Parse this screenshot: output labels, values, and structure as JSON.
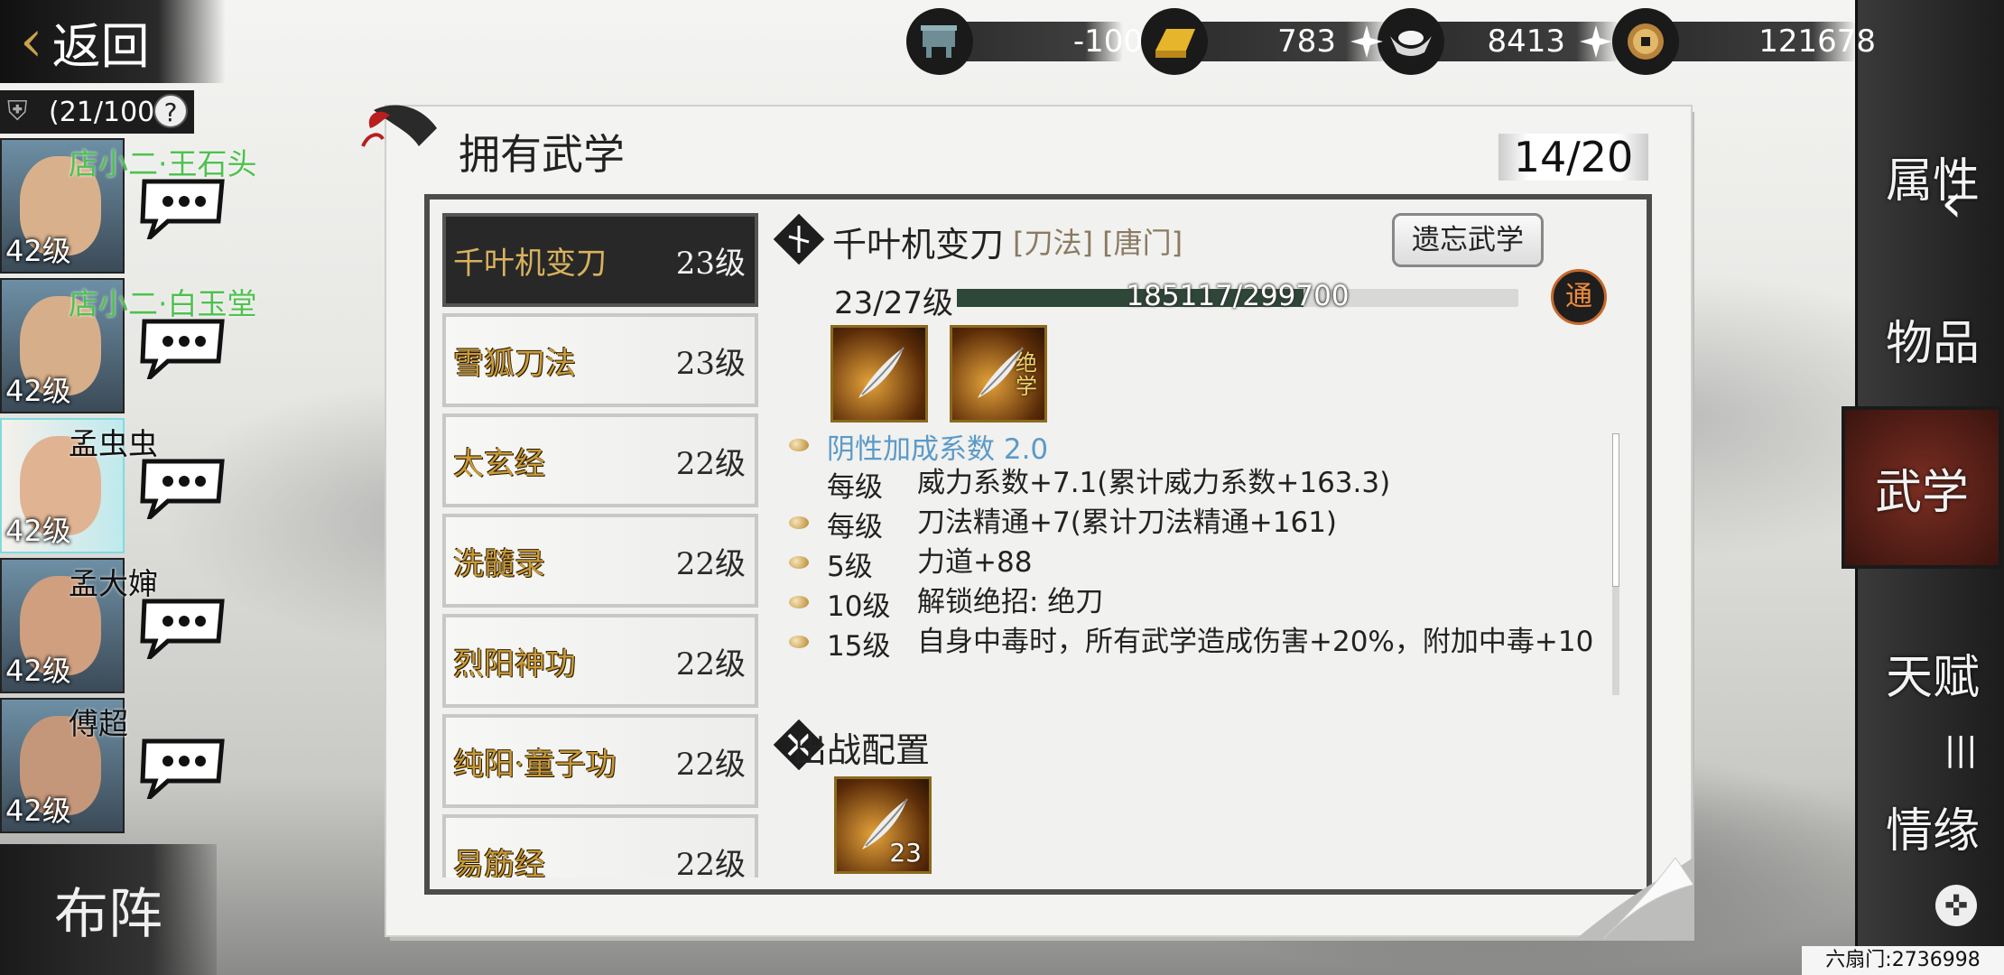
{
  "back": {
    "label": "返回"
  },
  "party": {
    "count": "(21/100",
    "help": "?"
  },
  "members": [
    {
      "name": "店小二·王石头",
      "level": "42级",
      "name_color": "#4ec24e",
      "skin": "#d8b08c"
    },
    {
      "name": "店小二·白玉堂",
      "level": "42级",
      "name_color": "#4ec24e",
      "skin": "#d6ae8a"
    },
    {
      "name": "孟虫虫",
      "level": "42级",
      "name_color": "#111111",
      "skin": "#e0b492"
    },
    {
      "name": "孟大婶",
      "level": "42级",
      "name_color": "#111111",
      "skin": "#cf9f80"
    },
    {
      "name": "傅超",
      "level": "42级",
      "name_color": "#111111",
      "skin": "#c4977a"
    }
  ],
  "formation": {
    "label": "布阵"
  },
  "currencies": [
    {
      "icon": "cart-icon",
      "value": "-100",
      "has_plus": false
    },
    {
      "icon": "gold-bar-icon",
      "value": "783",
      "has_plus": true
    },
    {
      "icon": "silver-ingot-icon",
      "value": "8413",
      "has_plus": true
    },
    {
      "icon": "coin-icon",
      "value": "121678",
      "has_plus": false
    }
  ],
  "nav": [
    {
      "label": "属性",
      "icon": "attribute-icon"
    },
    {
      "label": "物品",
      "icon": "items-icon"
    },
    {
      "label": "武学",
      "icon": "martial-arts-icon",
      "active": true
    },
    {
      "label": "天赋",
      "icon": "talent-icon"
    },
    {
      "label": "情缘",
      "icon": "relationship-icon"
    }
  ],
  "panel": {
    "title": "拥有武学",
    "count": "14/20"
  },
  "skills": [
    {
      "name": "千叶机变刀",
      "level": "23级",
      "active": true
    },
    {
      "name": "雪狐刀法",
      "level": "23级"
    },
    {
      "name": "太玄经",
      "level": "22级"
    },
    {
      "name": "洗髓录",
      "level": "22级"
    },
    {
      "name": "烈阳神功",
      "level": "22级"
    },
    {
      "name": "纯阳·童子功",
      "level": "22级"
    },
    {
      "name": "易筋经",
      "level": "22级"
    }
  ],
  "detail": {
    "title": "千叶机变刀",
    "tags": "[刀法] [唐门]",
    "forget_label": "遗忘武学",
    "level_text": "23/27级",
    "progress_text": "185117/299700",
    "progress_value": 0.6177,
    "badge": "通",
    "moves": [
      {
        "icon": "blade-skill-icon",
        "tag": ""
      },
      {
        "icon": "blade-ultimate-icon",
        "tag": "绝学"
      }
    ],
    "highlight": "阴性加成系数 2.0",
    "effects": [
      {
        "key": "每级",
        "value": "威力系数+7.1(累计威力系数+163.3)",
        "bullet": false
      },
      {
        "key": "每级",
        "value": "刀法精通+7(累计刀法精通+161)",
        "bullet": true
      },
      {
        "key": "5级",
        "value": "力道+88",
        "bullet": true
      },
      {
        "key": "10级",
        "value": "解锁绝招: 绝刀",
        "bullet": true
      },
      {
        "key": "15级",
        "value": "自身中毒时，所有武学造成伤害+20%，附加中毒+10",
        "bullet": true
      }
    ]
  },
  "battle": {
    "title": "出战配置",
    "slot_level": "23"
  },
  "footer": {
    "text": "六扇门:2736998"
  }
}
